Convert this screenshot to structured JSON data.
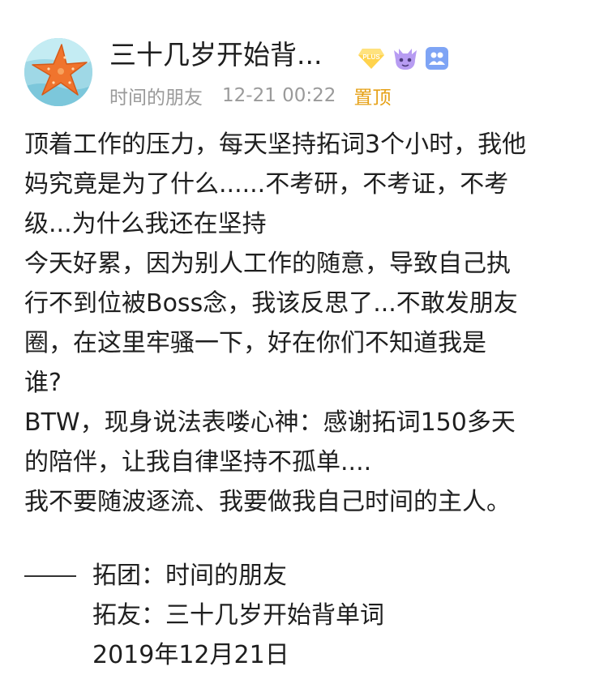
{
  "post": {
    "username": "三十几岁开始背...",
    "group": "时间的朋友",
    "time": "12-21 00:22",
    "pinned_label": "置顶",
    "badges": {
      "plus_text": "PLUS",
      "plus_color": "#ffd34d",
      "monster_color": "#b79cf2",
      "group_color": "#7ea4f5"
    },
    "avatar_icon": "starfish-icon",
    "content_lines": [
      "顶着工作的压力，每天坚持拓词3个小时，我他",
      "妈究竟是为了什么......不考研，不考证，不考",
      "级...为什么我还在坚持",
      "今天好累，因为别人工作的随意，导致自己执",
      "行不到位被Boss念，我该反思了...不敢发朋友",
      "圈，在这里牢骚一下，好在你们不知道我是",
      "谁?",
      "BTW，现身说法表喽心神：感谢拓词150多天",
      "的陪伴，让我自律坚持不孤单....",
      "我不要随波逐流、我要做我自己时间的主人。"
    ],
    "signature": {
      "group_line": "拓团：时间的朋友",
      "friend_line": "拓友：三十几岁开始背单词",
      "date_line": "2019年12月21日"
    }
  }
}
